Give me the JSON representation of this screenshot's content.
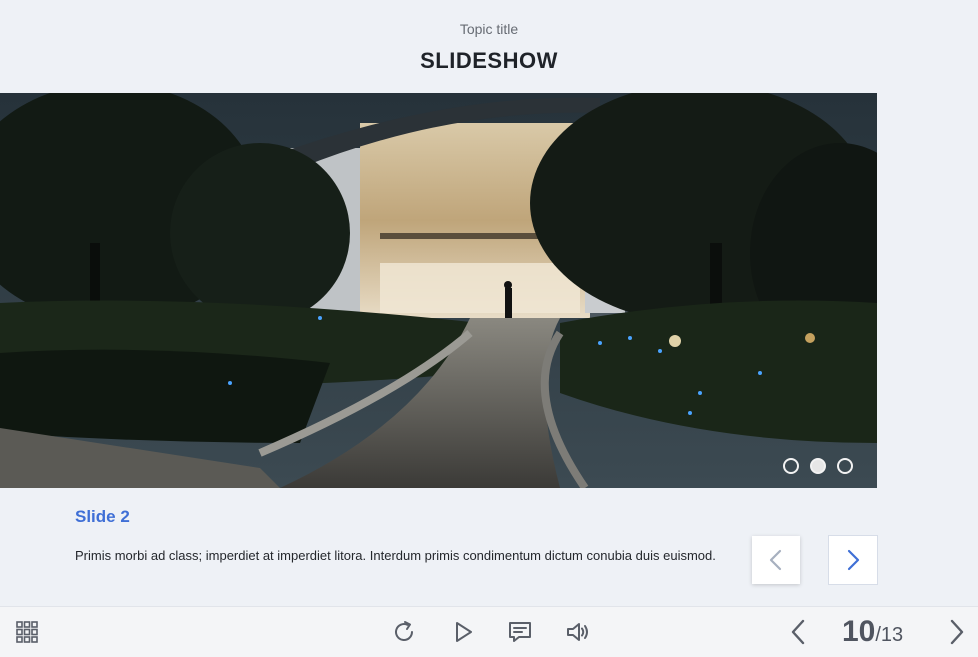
{
  "header": {
    "topic_title": "Topic title",
    "title": "SLIDESHOW"
  },
  "slideshow": {
    "image_alt": "Glass-fronted store at dusk with trees and curved stone walkway",
    "dots": [
      {
        "name": "slide-1",
        "active": false
      },
      {
        "name": "slide-2",
        "active": true
      },
      {
        "name": "slide-3",
        "active": false
      }
    ],
    "slide_heading": "Slide 2",
    "slide_text": "Primis morbi ad class; imperdiet at imperdiet litora. Interdum primis condimentum dictum conubia duis euismod.",
    "prev_icon": "chevron-left-icon",
    "next_icon": "chevron-right-icon"
  },
  "player_bar": {
    "menu_icon": "grid-menu-icon",
    "replay_icon": "replay-icon",
    "play_icon": "play-icon",
    "captions_icon": "captions-icon",
    "volume_icon": "volume-icon",
    "prev_icon": "chevron-left-icon",
    "next_icon": "chevron-right-icon",
    "current_page": "10",
    "total_pages": "/13"
  },
  "colors": {
    "accent": "#3f6fd6",
    "background": "#eef1f6",
    "bar": "#f4f5f7",
    "icon": "#5a5f69"
  }
}
